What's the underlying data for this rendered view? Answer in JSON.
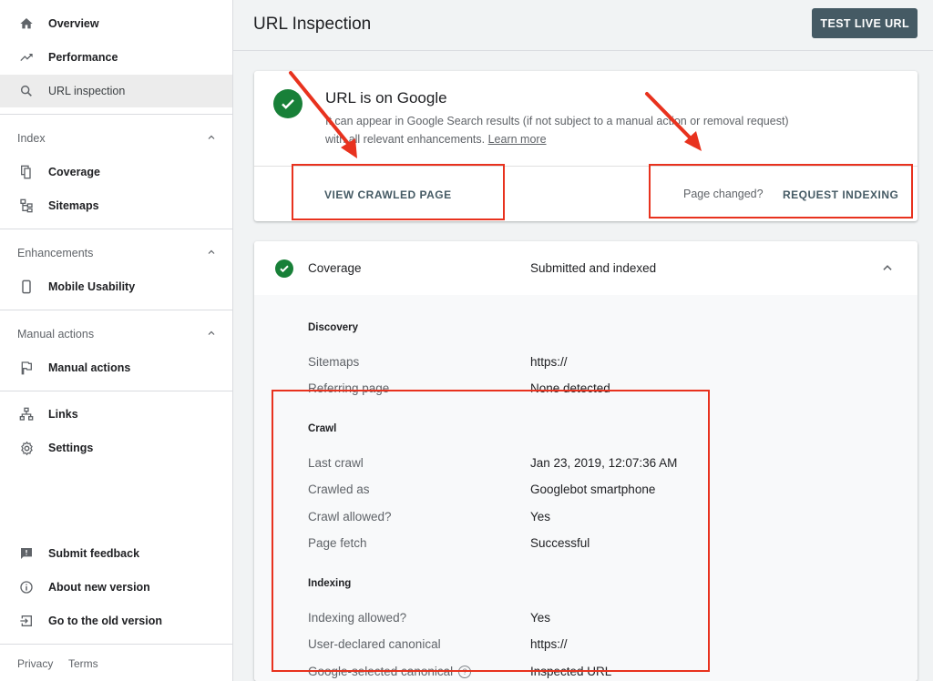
{
  "sidebar": {
    "items": [
      {
        "label": "Overview",
        "icon": "home-icon"
      },
      {
        "label": "Performance",
        "icon": "trending-up-icon"
      },
      {
        "label": "URL inspection",
        "icon": "search-icon"
      }
    ],
    "index": {
      "title": "Index",
      "items": [
        {
          "label": "Coverage",
          "icon": "file-copy-icon"
        },
        {
          "label": "Sitemaps",
          "icon": "sitemap-icon"
        }
      ]
    },
    "enhancements": {
      "title": "Enhancements",
      "items": [
        {
          "label": "Mobile Usability",
          "icon": "smartphone-icon"
        }
      ]
    },
    "manual_actions": {
      "title": "Manual actions",
      "items": [
        {
          "label": "Manual actions",
          "icon": "flag-icon"
        }
      ]
    },
    "other": [
      {
        "label": "Links",
        "icon": "link-tree-icon"
      },
      {
        "label": "Settings",
        "icon": "gear-icon"
      }
    ],
    "bottom": [
      {
        "label": "Submit feedback",
        "icon": "feedback-icon"
      },
      {
        "label": "About new version",
        "icon": "info-icon"
      },
      {
        "label": "Go to the old version",
        "icon": "exit-to-app-icon"
      }
    ],
    "footer": {
      "privacy": "Privacy",
      "terms": "Terms"
    }
  },
  "header": {
    "title": "URL Inspection",
    "test_live_url": "TEST LIVE URL"
  },
  "status_card": {
    "title": "URL is on Google",
    "description": "It can appear in Google Search results (if not subject to a manual action or removal request) with all relevant enhancements.",
    "learn_more": "Learn more",
    "view_crawled_page": "VIEW CRAWLED PAGE",
    "page_changed": "Page changed?",
    "request_indexing": "REQUEST INDEXING"
  },
  "coverage": {
    "label": "Coverage",
    "status": "Submitted and indexed",
    "discovery": {
      "title": "Discovery",
      "rows": [
        {
          "label": "Sitemaps",
          "value": "https://"
        },
        {
          "label": "Referring page",
          "value": "None detected"
        }
      ]
    },
    "crawl": {
      "title": "Crawl",
      "rows": [
        {
          "label": "Last crawl",
          "value": "Jan 23, 2019, 12:07:36 AM"
        },
        {
          "label": "Crawled as",
          "value": "Googlebot smartphone"
        },
        {
          "label": "Crawl allowed?",
          "value": "Yes"
        },
        {
          "label": "Page fetch",
          "value": "Successful"
        }
      ]
    },
    "indexing": {
      "title": "Indexing",
      "rows": [
        {
          "label": "Indexing allowed?",
          "value": "Yes"
        },
        {
          "label": "User-declared canonical",
          "value": "https://"
        },
        {
          "label": "Google-selected canonical",
          "value": "Inspected URL"
        }
      ]
    }
  },
  "colors": {
    "accent": "#455a64",
    "success": "#188038",
    "annotation": "#e8321e",
    "active_bg": "#ececec"
  }
}
